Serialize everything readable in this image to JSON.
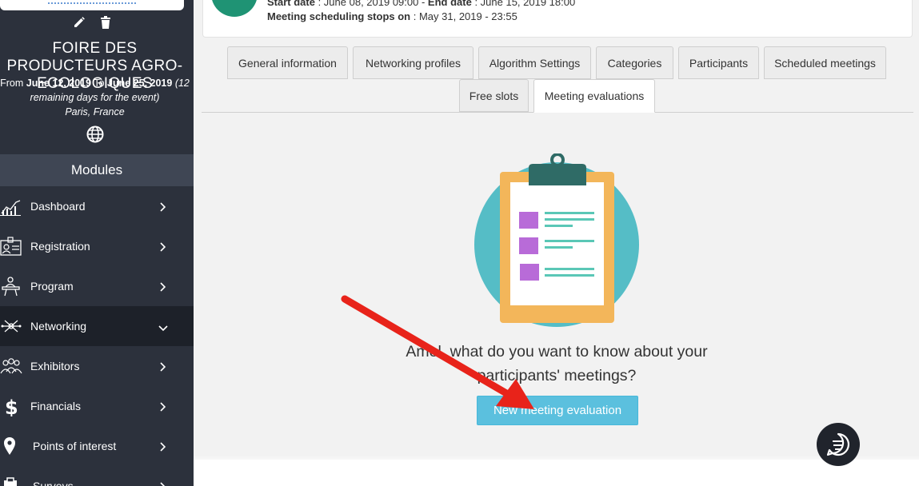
{
  "event": {
    "title": "FOIRE DES PRODUCTEURS AGRO-ECOLOGIQUES",
    "from_label": "From",
    "from_date": "June 12, 2019",
    "to_label": "To",
    "to_date": "June 25, 2019",
    "remaining": "(12 remaining days for the event)",
    "location": "Paris, France"
  },
  "sidebar": {
    "modules_label": "Modules",
    "items": [
      {
        "label": "Dashboard",
        "icon": "chart-icon"
      },
      {
        "label": "Registration",
        "icon": "id-card-icon"
      },
      {
        "label": "Program",
        "icon": "podium-icon"
      },
      {
        "label": "Networking",
        "icon": "network-icon"
      },
      {
        "label": "Exhibitors",
        "icon": "people-icon"
      },
      {
        "label": "Financials",
        "icon": "dollar-icon"
      },
      {
        "label": "Points of interest",
        "icon": "map-pin-icon"
      },
      {
        "label": "Surveys",
        "icon": "clipboard-icon"
      }
    ]
  },
  "header": {
    "start_label": "Start date",
    "start_value": " : June 08, 2019 09:00",
    "separator": " - ",
    "end_label": "End date",
    "end_value": " : June 15, 2019 18:00",
    "stops_label": "Meeting scheduling stops on",
    "stops_value": ": May 31, 2019 - 23:55"
  },
  "tabs": [
    {
      "label": "General information"
    },
    {
      "label": "Networking profiles"
    },
    {
      "label": "Algorithm Settings"
    },
    {
      "label": "Categories"
    },
    {
      "label": "Participants"
    },
    {
      "label": "Scheduled meetings"
    },
    {
      "label": "Free slots"
    },
    {
      "label": "Meeting evaluations"
    }
  ],
  "main": {
    "prompt": "Amel, what do you want to know about your participants' meetings?",
    "new_button": "New meeting evaluation"
  },
  "colors": {
    "sidebar_bg": "#2c313c",
    "accent_button": "#5bc0de",
    "avatar": "#1f9374",
    "annotation_arrow": "#e8231a"
  }
}
